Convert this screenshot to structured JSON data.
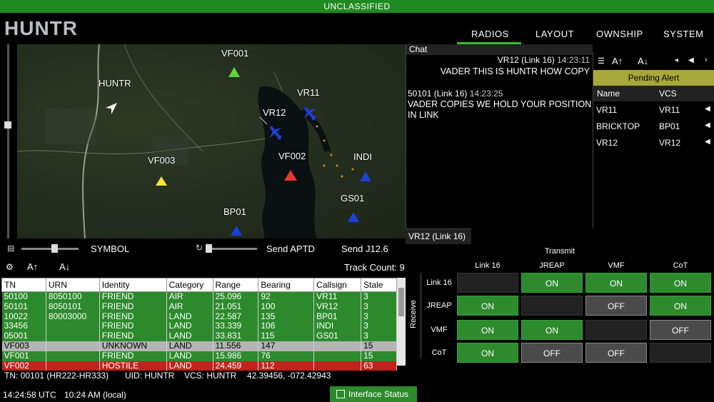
{
  "classification": "UNCLASSIFIED",
  "app": {
    "logo": "HUNTR"
  },
  "nav": {
    "radios": "RADIOS",
    "layout": "LAYOUT",
    "ownship": "OWNSHIP",
    "system": "SYSTEM"
  },
  "map": {
    "labels": {
      "vf001": "VF001",
      "huntr": "HUNTR",
      "vr11": "VR11",
      "vr12": "VR12",
      "vf002": "VF002",
      "vf003": "VF003",
      "indi": "INDI",
      "gs01": "GS01",
      "bp01": "BP01"
    }
  },
  "map_tools": {
    "symbol": "SYMBOL",
    "send_aptd": "Send APTD",
    "send_j12": "Send J12.6"
  },
  "tracks": {
    "count_label": "Track Count: 9",
    "columns": [
      "TN",
      "URN",
      "Identity",
      "Category",
      "Range",
      "Bearing",
      "Callsign",
      "Stale"
    ],
    "rows": [
      [
        "50100",
        "8050100",
        "FRIEND",
        "AIR",
        "25.096",
        "92",
        "VR11",
        "3"
      ],
      [
        "50101",
        "8050101",
        "FRIEND",
        "AIR",
        "21.051",
        "100",
        "VR12",
        "3"
      ],
      [
        "10022",
        "80003000",
        "FRIEND",
        "LAND",
        "22.587",
        "135",
        "BP01",
        "3"
      ],
      [
        "33456",
        "",
        "FRIEND",
        "LAND",
        "33.339",
        "106",
        "INDI",
        "3"
      ],
      [
        "05001",
        "",
        "FRIEND",
        "LAND",
        "33.831",
        "115",
        "GS01",
        "3"
      ],
      [
        "VF003",
        "",
        "UNKNOWN",
        "LAND",
        "11.556",
        "147",
        "",
        "15"
      ],
      [
        "VF001",
        "",
        "FRIEND",
        "LAND",
        "15.986",
        "76",
        "",
        "15"
      ],
      [
        "VF002",
        "",
        "HOSTILE",
        "LAND",
        "24.459",
        "112",
        "",
        "63"
      ]
    ]
  },
  "status": {
    "tn": "TN: 00101 (HR222-HR333)",
    "uid": "UID: HUNTR",
    "vcs": "VCS: HUNTR",
    "coords": "42.39456, -072.42943",
    "utc": "14:24:58 UTC",
    "local": "10:24 AM (local)",
    "interface": "Interface Status"
  },
  "chat": {
    "title": "Chat",
    "msg1_header": "VR12 (Link 16)",
    "msg1_time": "14:23:11",
    "msg1_text": "VADER THIS IS HUNTR HOW COPY",
    "msg2_header": "50101 (Link 16)",
    "msg2_time": "14:23:25",
    "msg2_text_1": "VADER COPIES WE HOLD YOUR POSITION",
    "msg2_text_2": "IN LINK"
  },
  "alerts": {
    "pending": "Pending Alert",
    "col_name": "Name",
    "col_vcs": "VCS",
    "rows": [
      {
        "name": "VR11",
        "vcs": "VR11"
      },
      {
        "name": "BRICKTOP",
        "vcs": "BP01"
      },
      {
        "name": "VR12",
        "vcs": "VR12"
      }
    ]
  },
  "transmit": {
    "tab": "VR12 (Link 16)",
    "title": "Transmit",
    "receive": "Receive",
    "cols": [
      "Link 16",
      "JREAP",
      "VMF",
      "CoT"
    ],
    "rows": [
      "Link 16",
      "JREAP",
      "VMF",
      "CoT"
    ],
    "grid": [
      [
        "",
        "ON",
        "ON",
        "ON"
      ],
      [
        "ON",
        "",
        "OFF",
        "ON"
      ],
      [
        "ON",
        "ON",
        "",
        "OFF"
      ],
      [
        "ON",
        "OFF",
        "OFF",
        ""
      ]
    ]
  },
  "colors": {
    "friend": "#2c8a2c",
    "unknown": "#b5b5b5",
    "hostile": "#c0221e",
    "alert": "#a8a83a"
  }
}
